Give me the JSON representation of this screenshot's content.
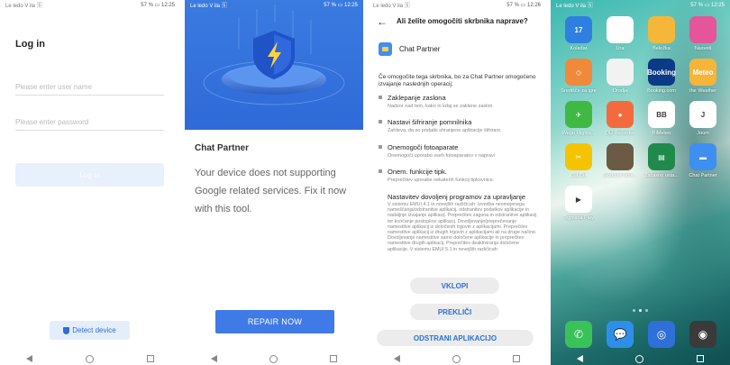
{
  "screen1": {
    "status": {
      "left": "Le ledo V ila 🅂",
      "right": "57 % ▭ 12:25"
    },
    "title": "Log in",
    "username_placeholder": "Please enter user name",
    "password_placeholder": "Please enter password",
    "login_label": "Log in",
    "detect_label": "Detect device"
  },
  "screen2": {
    "status": {
      "left": "Le ledo V ila 🅂",
      "right": "57 % ▭ 12:25"
    },
    "title": "Chat Partner",
    "message": "Your device does not supporting Google related services. Fix it now with this tool.",
    "repair_label": "REPAIR NOW"
  },
  "screen3": {
    "status": {
      "left": "Le ledo V ila 🅂",
      "right": "57 % ▭ 12:26"
    },
    "header": "Ali želite omogočiti skrbnika naprave?",
    "app_name": "Chat Partner",
    "intro": "Če omogočite tega skrbnika, bo za Chat Partner omogočeno izvajanje naslednjih operacij:",
    "permissions": [
      {
        "title": "Zaklepanje zaslona",
        "desc": "Nadzor nad tem, kako in kdaj se zaklene zaslon"
      },
      {
        "title": "Nastavi šifriranje pomnilnika",
        "desc": "Zahteva, da so podatki shranjene aplikacije šifrirani."
      },
      {
        "title": "Onemogoči fotoaparate",
        "desc": "Onemogoči uporabo vseh fotoaparatov v napravi"
      },
      {
        "title": "Onem. funkcije tipk.",
        "desc": "Preprečitev uporabe nekaterih funkcij tipkovnice."
      }
    ],
    "admin_title": "Nastavitev dovoljenj programov za upravljanje",
    "admin_desc": "V sistemu EMUI 4.1 in novejših različicah: Izvedba neomejenega nameščanja/odstranitve aplikacij, odstranitev podatkov aplikacije in nadaljnje izvajanje aplikacij. Preprečitev zagona in odstranitve aplikacij ter končanje postopkov aplikacij. Dovoljevanje/preprečevanje namestitve aplikacij iz določenih trgovin z aplikacijami. Preprečitev namestitve aplikacij iz drugih trgovin z aplikacijami ali na druge načine. Dovoljevanje namestitve samo določene aplikacije in preprečitev namestitve drugih aplikacij. Preprečitev deaktiviranja določene aplikacije. V sistemu EMUI 5.1 in novejših različicah:",
    "enable_label": "VKLOPI",
    "cancel_label": "PREKLIČI",
    "uninstall_label": "ODSTRANI APLIKACIJO"
  },
  "screen4": {
    "status": {
      "left": "Le ledo V ila 🅂",
      "right": "57 % ▭ 12:25"
    },
    "apps": [
      {
        "label": "Koledar",
        "icon": "calendar-icon",
        "color": "#2f7fe0",
        "text": "17"
      },
      {
        "label": "Ura",
        "icon": "clock-icon",
        "color": "#ffffff",
        "text": ""
      },
      {
        "label": "Beležka",
        "icon": "notes-icon",
        "color": "#f4b73a",
        "text": ""
      },
      {
        "label": "Nasveti",
        "icon": "tips-icon",
        "color": "#e4559a",
        "text": ""
      },
      {
        "label": "Središče za igre",
        "icon": "game-center-icon",
        "color": "#f0893a",
        "text": "◇"
      },
      {
        "label": "Orodja",
        "icon": "tools-icon",
        "color": "#f2f2f2",
        "text": ""
      },
      {
        "label": "Booking.com",
        "icon": "booking-icon",
        "color": "#0b3a86",
        "text": "Booking"
      },
      {
        "label": "the Weather",
        "icon": "weather-icon",
        "color": "#f5b53a",
        "text": "Meteo"
      },
      {
        "label": "Wego Flights...",
        "icon": "wego-icon",
        "color": "#3fb944",
        "text": "✈"
      },
      {
        "label": "DU Recorder",
        "icon": "recorder-icon",
        "color": "#f26a3d",
        "text": "●"
      },
      {
        "label": "BiMeteo",
        "icon": "bimeteo-icon",
        "color": "#ffffff",
        "text": "BB"
      },
      {
        "label": "Joom",
        "icon": "joom-icon",
        "color": "#ffffff",
        "text": "J"
      },
      {
        "label": "Cut Cut",
        "icon": "cutcut-icon",
        "color": "#f5c400",
        "text": "✂"
      },
      {
        "label": "World of Tank...",
        "icon": "tanks-icon",
        "color": "#6b5a44",
        "text": ""
      },
      {
        "label": "Začasno usta...",
        "icon": "temp-icon",
        "color": "#1f8a4c",
        "text": "▤"
      },
      {
        "label": "Chat Partner",
        "icon": "chat-partner-icon",
        "color": "#3f8ff0",
        "text": "▬"
      },
      {
        "label": "Trgovina Play",
        "icon": "play-store-icon",
        "color": "#ffffff",
        "text": "▶"
      }
    ],
    "dock": [
      {
        "icon": "phone-icon",
        "color": "#39c25a",
        "text": "✆"
      },
      {
        "icon": "messages-icon",
        "color": "#2f8fe8",
        "text": "💬"
      },
      {
        "icon": "browser-icon",
        "color": "#2f6fd8",
        "text": "◎"
      },
      {
        "icon": "camera-icon",
        "color": "#3a3a3a",
        "text": "◉"
      }
    ]
  }
}
